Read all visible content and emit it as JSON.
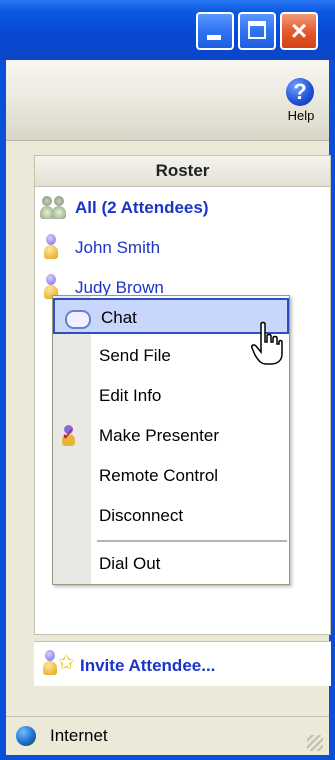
{
  "window": {
    "titlebar_buttons": [
      "minimize",
      "maximize",
      "close"
    ]
  },
  "toolbar": {
    "help_label": "Help"
  },
  "roster": {
    "header": "Roster",
    "all_label": "All (2 Attendees)",
    "attendees": [
      "John Smith",
      "Judy Brown"
    ]
  },
  "context_menu": {
    "items": [
      "Chat",
      "Send File",
      "Edit Info",
      "Make Presenter",
      "Remote Control",
      "Disconnect",
      "Dial Out"
    ],
    "highlighted": "Chat"
  },
  "invite": {
    "label": "Invite Attendee..."
  },
  "status": {
    "zone": "Internet"
  },
  "colors": {
    "titlebar_blue": "#0a4fd8",
    "link_blue": "#1b35c8",
    "menu_highlight": "#c8d6fb",
    "menu_highlight_border": "#2d4fbf"
  }
}
